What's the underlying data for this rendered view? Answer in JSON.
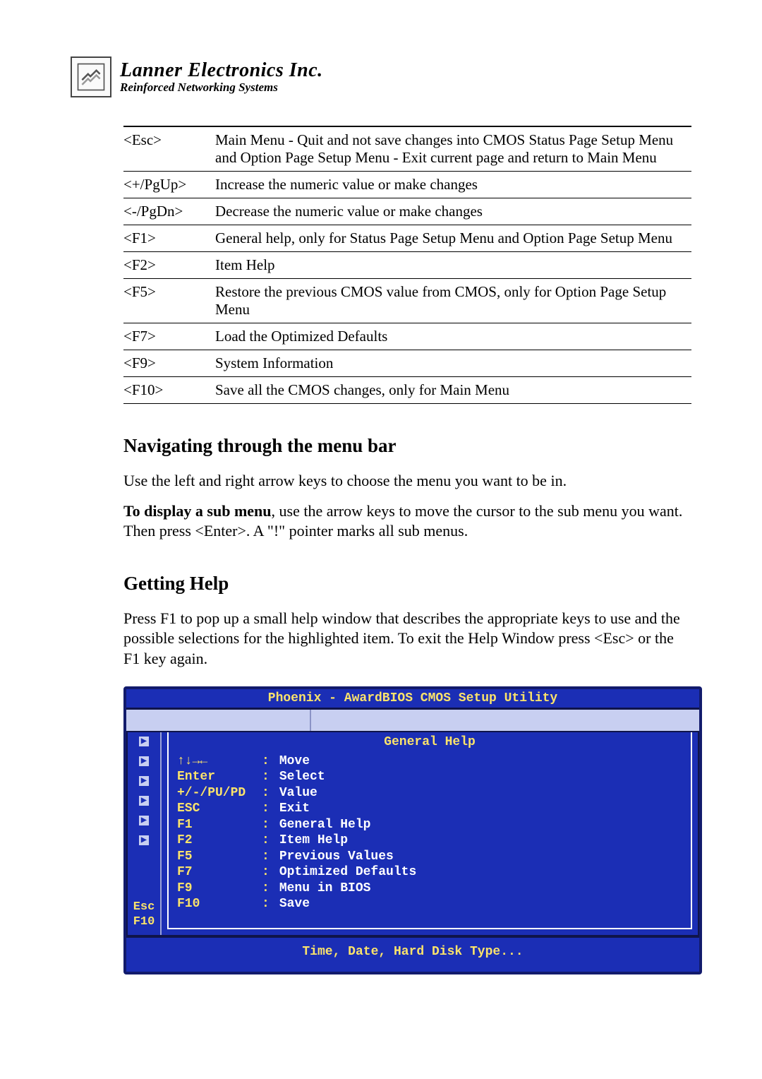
{
  "brand": {
    "name_prefix": "Lanner",
    "name_suffix": " Electronics Inc.",
    "tagline": "Reinforced Networking Systems"
  },
  "key_table": [
    {
      "key": "<Esc>",
      "desc": "Main Menu - Quit and not save changes into CMOS Status Page Setup Menu and Option Page Setup Menu - Exit current page and return to Main Menu"
    },
    {
      "key": "<+/PgUp>",
      "desc": "Increase the numeric value or make changes"
    },
    {
      "key": "<-/PgDn>",
      "desc": "Decrease the numeric value or make changes"
    },
    {
      "key": "<F1>",
      "desc": "General help, only for Status Page Setup Menu and Option Page Setup Menu"
    },
    {
      "key": "<F2>",
      "desc": "Item Help"
    },
    {
      "key": "<F5>",
      "desc": "Restore the previous CMOS value from CMOS, only for Option Page Setup Menu"
    },
    {
      "key": "<F7>",
      "desc": "Load the Optimized Defaults"
    },
    {
      "key": "<F9>",
      "desc": "System Information"
    },
    {
      "key": "<F10>",
      "desc": "Save all the CMOS changes, only for Main Menu"
    }
  ],
  "sections": {
    "nav_heading": "Navigating through the menu bar",
    "nav_p1": "Use the left and right arrow keys to choose the menu you want to be in.",
    "nav_p2_bold": "To display a sub menu",
    "nav_p2_rest": ", use the arrow keys to move the cursor to the sub menu you want. Then press <Enter>. A \"!\" pointer marks all sub menus.",
    "help_heading": "Getting Help",
    "help_p1": "Press F1 to pop up a small help window that describes the appropriate keys to use and the possible selections for the highlighted item. To exit the Help Window press <Esc> or the F1 key again."
  },
  "bios": {
    "title": "Phoenix - AwardBIOS CMOS Setup Utility",
    "help_title": "General Help",
    "rows": [
      {
        "key": "↑↓→←",
        "desc": "Move"
      },
      {
        "key": "Enter",
        "desc": "Select"
      },
      {
        "key": "+/-/PU/PD",
        "desc": "Value"
      },
      {
        "key": "ESC",
        "desc": "Exit"
      },
      {
        "key": "F1",
        "desc": "General Help"
      },
      {
        "key": "F2",
        "desc": "Item Help"
      },
      {
        "key": "F5",
        "desc": "Previous Values"
      },
      {
        "key": "F7",
        "desc": "Optimized Defaults"
      },
      {
        "key": "F9",
        "desc": "Menu in BIOS"
      },
      {
        "key": "F10",
        "desc": "Save"
      }
    ],
    "side_keys": {
      "esc": "Esc",
      "f10": "F10"
    },
    "footer": "Time, Date, Hard Disk Type..."
  }
}
